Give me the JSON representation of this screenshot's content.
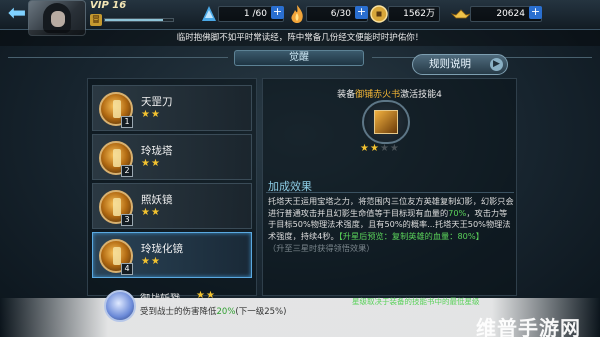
{
  "topbar": {
    "vip_label": "VIP 16",
    "rank_badge": "冒",
    "xp_fill": 0.85,
    "stamina": "1 /60",
    "energy": "6/30",
    "coins": "1562万",
    "ingots": "20624",
    "plus": "+"
  },
  "notice": "临时抱佛脚不如平时常读经，阵中常备几份经文便能时时护佑你！",
  "header": {
    "title": "觉醒",
    "rules_label": "规则说明",
    "rules_arrow": "▶"
  },
  "skills": [
    {
      "name": "天罡刀",
      "num": "1",
      "stars_on": "★★",
      "stars_off": ""
    },
    {
      "name": "玲珑塔",
      "num": "2",
      "stars_on": "★★",
      "stars_off": ""
    },
    {
      "name": "照妖镜",
      "num": "3",
      "stars_on": "★★",
      "stars_off": ""
    },
    {
      "name": "玲珑化镜",
      "num": "4",
      "stars_on": "★★",
      "stars_off": ""
    }
  ],
  "detail": {
    "equip_prefix": "装备",
    "equip_item": "御铺赤火书",
    "equip_suffix": "激活技能4",
    "equip_stars_on": "★★",
    "equip_stars_off": "★★",
    "bonus_title": "加成效果",
    "desc_main": "托塔天王运用宝塔之力，将范围内三位友方英雄复制幻影，幻影只会进行普通攻击并且幻影生命值等于目标现有血量的",
    "desc_pct1": "70%",
    "desc_mid": "，攻击力等于目标50%物理法术强度，且有50%的概率...托塔天王50%物理法术强度，持续4秒。",
    "desc_upgrade_label": "【升星后预览：复制英雄的血量：",
    "desc_pct2": "80%",
    "desc_upgrade_end": "】",
    "desc_hint": "（升至三星时获得领悟效果）"
  },
  "toast": {
    "peek_name": "御战斩戮",
    "peek_stars": "★★",
    "text_prefix": "受到战士的伤害降低",
    "text_value": "20%",
    "text_suffix": "(下一级25%)",
    "note": "星级取决于装备的技能书中的最低星级"
  },
  "watermark": "维普手游网"
}
